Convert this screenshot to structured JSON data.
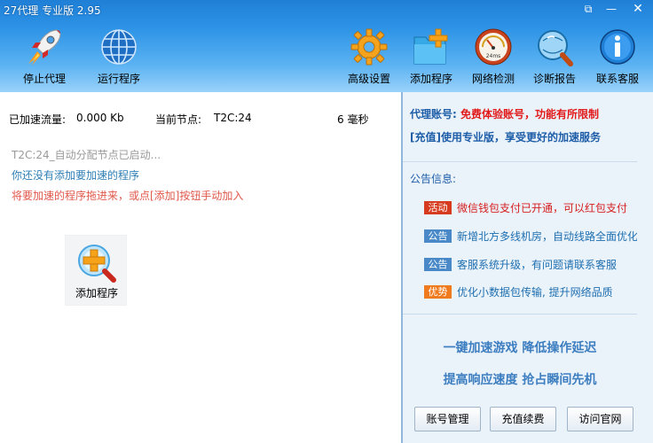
{
  "window": {
    "title": "27代理 专业版 2.95",
    "controls": {
      "restore": "⧉",
      "minimize": "—",
      "close": "✕"
    }
  },
  "toolbar": {
    "left": [
      {
        "label": "停止代理",
        "icon": "rocket-icon"
      },
      {
        "label": "运行程序",
        "icon": "globe-icon"
      }
    ],
    "right": [
      {
        "label": "高级设置",
        "icon": "gear-icon"
      },
      {
        "label": "添加程序",
        "icon": "folder-plus-icon"
      },
      {
        "label": "网络检测",
        "icon": "speedometer-icon",
        "badge": "24ms"
      },
      {
        "label": "诊断报告",
        "icon": "magnifier-globe-icon"
      },
      {
        "label": "联系客服",
        "icon": "info-icon"
      }
    ]
  },
  "status": {
    "traffic_label": "已加速流量:",
    "traffic_value": "0.000 Kb",
    "node_label": "当前节点:",
    "node_value": "T2C:24",
    "latency": "6 毫秒"
  },
  "log": [
    "T2C:24_自动分配节点已启动...",
    "你还没有添加要加速的程序",
    "将要加速的程序拖进来，或点[添加]按钮手动加入"
  ],
  "add_tile": {
    "label": "添加程序",
    "icon": "add-program-icon"
  },
  "account": {
    "label": "代理账号:",
    "value": "免费体验账号，功能有所限制",
    "recharge": "[充值]使用专业版，享受更好的加速服务"
  },
  "notices": {
    "title": "公告信息:",
    "items": [
      {
        "tag": "活动",
        "tag_color": "#d63b1f",
        "text": "微信钱包支付已开通，可以红包支付",
        "text_color": "#d61f1f"
      },
      {
        "tag": "公告",
        "tag_color": "#4a89c8",
        "text": "新增北方多线机房，自动线路全面优化",
        "text_color": "#1e6fb0"
      },
      {
        "tag": "公告",
        "tag_color": "#4a89c8",
        "text": "客服系统升级，有问题请联系客服",
        "text_color": "#1e6fb0"
      },
      {
        "tag": "优势",
        "tag_color": "#f07a1e",
        "text": "优化小数据包传输, 提升网络品质",
        "text_color": "#1e6fb0"
      }
    ]
  },
  "slogans": [
    "一键加速游戏  降低操作延迟",
    "提高响应速度  抢占瞬间先机"
  ],
  "buttons": {
    "account": "账号管理",
    "recharge": "充值续费",
    "website": "访问官网"
  }
}
